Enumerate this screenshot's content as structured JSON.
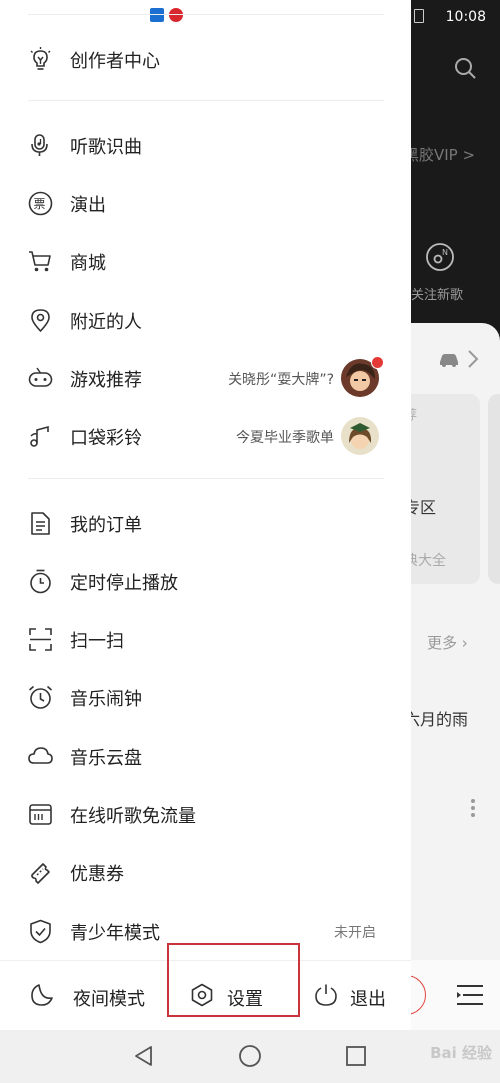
{
  "status_bar": {
    "time": "10:08"
  },
  "background_app": {
    "vip_text": "黑胶VIP >",
    "new_song_label": "关注新歌",
    "recommend_label": "荐",
    "zone_label": "专区",
    "full_label": "典大全",
    "more_label": "更多",
    "rain_text": "六月的雨"
  },
  "drawer": {
    "creator_center": "创作者中心",
    "section1": [
      {
        "label": "听歌识曲",
        "icon": "mic-music-icon"
      },
      {
        "label": "演出",
        "icon": "ticket-icon"
      },
      {
        "label": "商城",
        "icon": "cart-icon"
      },
      {
        "label": "附近的人",
        "icon": "location-pin-icon"
      },
      {
        "label": "游戏推荐",
        "icon": "gamepad-icon",
        "hint": "关晓彤“耍大牌”?"
      },
      {
        "label": "口袋彩铃",
        "icon": "music-note-icon",
        "hint": "今夏毕业季歌单"
      }
    ],
    "section2": [
      {
        "label": "我的订单",
        "icon": "document-icon"
      },
      {
        "label": "定时停止播放",
        "icon": "timer-icon"
      },
      {
        "label": "扫一扫",
        "icon": "scan-icon"
      },
      {
        "label": "音乐闹钟",
        "icon": "alarm-clock-icon"
      },
      {
        "label": "音乐云盘",
        "icon": "cloud-icon"
      },
      {
        "label": "在线听歌免流量",
        "icon": "sim-card-icon"
      },
      {
        "label": "优惠券",
        "icon": "coupon-icon"
      },
      {
        "label": "青少年模式",
        "icon": "shield-check-icon",
        "hint": "未开启"
      }
    ],
    "bottom": {
      "night_mode": "夜间模式",
      "settings": "设置",
      "logout": "退出"
    }
  },
  "watermark": "Bai 经验",
  "colors": {
    "accent_red": "#e53935",
    "highlight_box": "#c9343a"
  }
}
